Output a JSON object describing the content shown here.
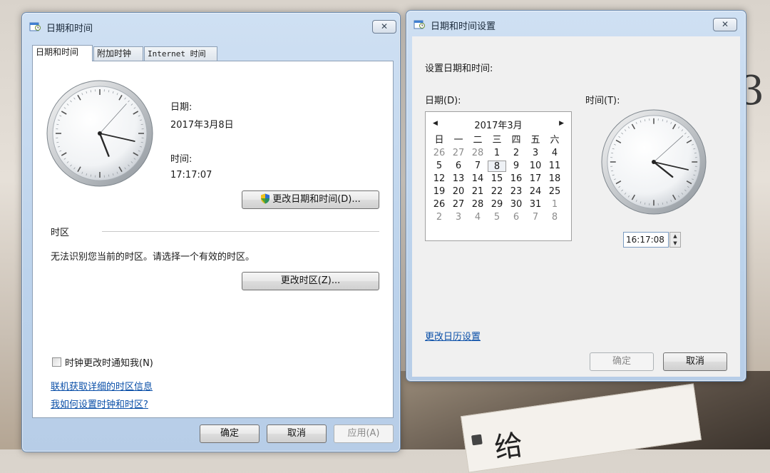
{
  "date_time_window": {
    "title": "日期和时间",
    "close_label": "✕",
    "tabs": [
      {
        "label": "日期和时间"
      },
      {
        "label": "附加时钟"
      },
      {
        "label": "Internet 时间"
      }
    ],
    "date_label": "日期:",
    "date_value": "2017年3月8日",
    "time_label": "时间:",
    "time_value": "17:17:07",
    "change_datetime_button": "更改日期和时间(D)...",
    "timezone_section": "时区",
    "timezone_message": "无法识别您当前的时区。请选择一个有效的时区。",
    "change_timezone_button": "更改时区(Z)...",
    "notify_checkbox_label": "时钟更改时通知我(N)",
    "notify_checked": false,
    "link_timezone_info": "联机获取详细的时区信息",
    "link_how_to": "我如何设置时钟和时区?",
    "ok_button": "确定",
    "cancel_button": "取消",
    "apply_button": "应用(A)"
  },
  "settings_window": {
    "title": "日期和时间设置",
    "close_label": "✕",
    "heading": "设置日期和时间:",
    "date_label": "日期(D):",
    "time_label": "时间(T):",
    "calendar": {
      "prev_icon": "◀",
      "next_icon": "▶",
      "month_title": "2017年3月",
      "weekdays": [
        "日",
        "一",
        "二",
        "三",
        "四",
        "五",
        "六"
      ],
      "weeks": [
        [
          "26",
          "27",
          "28",
          "1",
          "2",
          "3",
          "4"
        ],
        [
          "5",
          "6",
          "7",
          "8",
          "9",
          "10",
          "11"
        ],
        [
          "12",
          "13",
          "14",
          "15",
          "16",
          "17",
          "18"
        ],
        [
          "19",
          "20",
          "21",
          "22",
          "23",
          "24",
          "25"
        ],
        [
          "26",
          "27",
          "28",
          "29",
          "30",
          "31",
          "1"
        ],
        [
          "2",
          "3",
          "4",
          "5",
          "6",
          "7",
          "8"
        ]
      ],
      "selected_day": "8"
    },
    "time_input_value": "16:17:08",
    "change_calendar_link": "更改日历设置",
    "ok_button": "确定",
    "cancel_button": "取消"
  },
  "clock_left": {
    "hours": 17,
    "minutes": 17,
    "seconds": 7
  },
  "clock_right": {
    "hours": 16,
    "minutes": 17,
    "seconds": 8
  },
  "background": {
    "book_title": "给",
    "side_glyph": "3"
  },
  "colors": {
    "link": "#0a4fa8",
    "window_frame": "#bcd3ec"
  }
}
